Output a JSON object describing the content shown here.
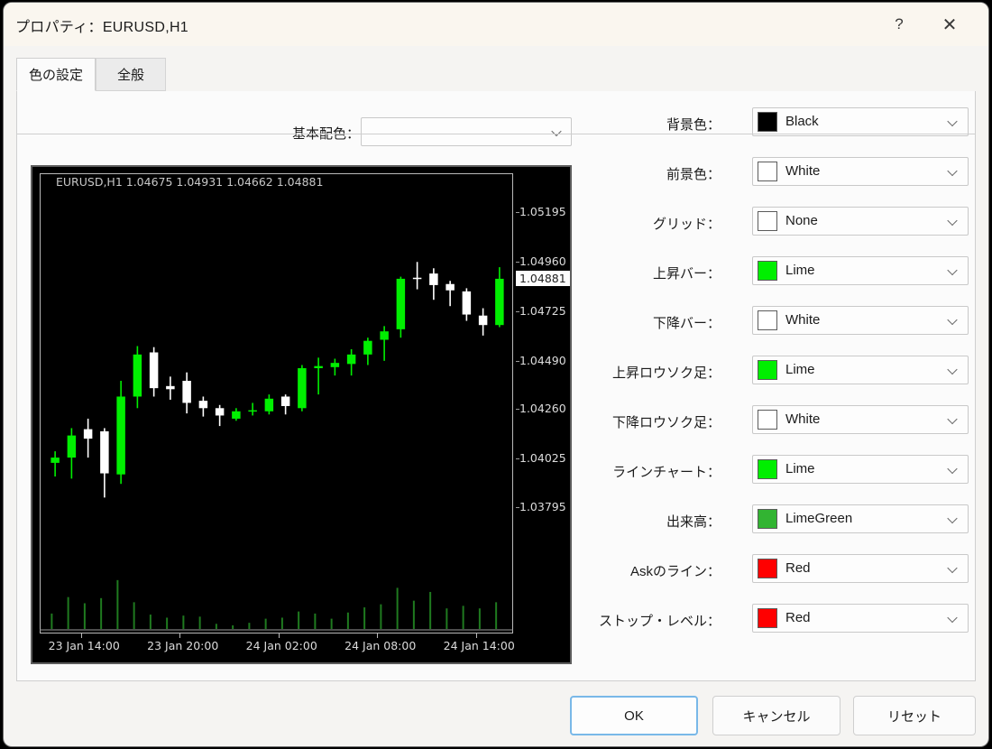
{
  "window": {
    "title": "プロパティ：EURUSD,H1",
    "help_icon": "?",
    "close_icon": "✕"
  },
  "tabs": [
    {
      "label": "色の設定",
      "active": true
    },
    {
      "label": "全般",
      "active": false
    }
  ],
  "scheme": {
    "label": "基本配色：",
    "value": "",
    "chevron_icon": "chevron-down-icon"
  },
  "color_rows": [
    {
      "label": "背景色：",
      "value": "Black",
      "hex": "#000000"
    },
    {
      "label": "前景色：",
      "value": "White",
      "hex": "#ffffff"
    },
    {
      "label": "グリッド：",
      "value": "None",
      "hex": "#ffffff"
    },
    {
      "label": "上昇バー：",
      "value": "Lime",
      "hex": "#00ef00"
    },
    {
      "label": "下降バー：",
      "value": "White",
      "hex": "#ffffff"
    },
    {
      "label": "上昇ロウソク足：",
      "value": "Lime",
      "hex": "#00ef00"
    },
    {
      "label": "下降ロウソク足：",
      "value": "White",
      "hex": "#ffffff"
    },
    {
      "label": "ラインチャート：",
      "value": "Lime",
      "hex": "#00ef00"
    },
    {
      "label": "出来高：",
      "value": "LimeGreen",
      "hex": "#32b432"
    },
    {
      "label": "Askのライン：",
      "value": "Red",
      "hex": "#ff0000"
    },
    {
      "label": "ストップ・レベル：",
      "value": "Red",
      "hex": "#ff0000"
    }
  ],
  "footer": {
    "ok": "OK",
    "cancel": "キャンセル",
    "reset": "リセット"
  },
  "chart_data": {
    "type": "candlestick",
    "title": "EURUSD,H1  1.04675 1.04931 1.04662 1.04881",
    "symbol": "EURUSD,H1",
    "ohlc": {
      "open": "1.04675",
      "high": "1.04931",
      "low": "1.04662",
      "close": "1.04881"
    },
    "background": "#000000",
    "up_color": "#00ef00",
    "down_color": "#ffffff",
    "volume_color": "#1f7a1f",
    "grid": false,
    "current_price": "1.04881",
    "ylim": [
      1.037,
      1.0527
    ],
    "ytick_labels": [
      "1.05195",
      "1.04960",
      "1.04725",
      "1.04490",
      "1.04260",
      "1.04025",
      "1.03795"
    ],
    "ytick_values": [
      1.05195,
      1.0496,
      1.04725,
      1.0449,
      1.0426,
      1.04025,
      1.03795
    ],
    "xtick_labels": [
      "23 Jan 14:00",
      "23 Jan 20:00",
      "24 Jan 02:00",
      "24 Jan 08:00",
      "24 Jan 14:00"
    ],
    "xtick_indices": [
      2,
      8,
      14,
      20,
      26
    ],
    "candles": [
      {
        "o": 1.04005,
        "h": 1.0406,
        "l": 1.0394,
        "c": 1.0403,
        "v": 0.3
      },
      {
        "o": 1.0403,
        "h": 1.0417,
        "l": 1.0393,
        "c": 1.04135,
        "v": 0.62
      },
      {
        "o": 1.04165,
        "h": 1.04215,
        "l": 1.0403,
        "c": 1.0412,
        "v": 0.5
      },
      {
        "o": 1.04155,
        "h": 1.0417,
        "l": 1.0384,
        "c": 1.03955,
        "v": 0.6
      },
      {
        "o": 1.0395,
        "h": 1.04395,
        "l": 1.03905,
        "c": 1.0432,
        "v": 0.95
      },
      {
        "o": 1.0432,
        "h": 1.0456,
        "l": 1.04265,
        "c": 1.0452,
        "v": 0.52
      },
      {
        "o": 1.0453,
        "h": 1.04555,
        "l": 1.0432,
        "c": 1.0436,
        "v": 0.28
      },
      {
        "o": 1.0437,
        "h": 1.04415,
        "l": 1.04305,
        "c": 1.04355,
        "v": 0.22
      },
      {
        "o": 1.04395,
        "h": 1.04435,
        "l": 1.0424,
        "c": 1.0429,
        "v": 0.26
      },
      {
        "o": 1.043,
        "h": 1.0432,
        "l": 1.04225,
        "c": 1.04265,
        "v": 0.24
      },
      {
        "o": 1.04265,
        "h": 1.0428,
        "l": 1.0418,
        "c": 1.0423,
        "v": 0.1
      },
      {
        "o": 1.04215,
        "h": 1.04265,
        "l": 1.04205,
        "c": 1.0425,
        "v": 0.07
      },
      {
        "o": 1.0425,
        "h": 1.0429,
        "l": 1.0423,
        "c": 1.04255,
        "v": 0.12
      },
      {
        "o": 1.0425,
        "h": 1.0433,
        "l": 1.04235,
        "c": 1.0431,
        "v": 0.2
      },
      {
        "o": 1.0432,
        "h": 1.0433,
        "l": 1.04235,
        "c": 1.04275,
        "v": 0.22
      },
      {
        "o": 1.04265,
        "h": 1.0447,
        "l": 1.0425,
        "c": 1.04455,
        "v": 0.34
      },
      {
        "o": 1.04455,
        "h": 1.04505,
        "l": 1.0433,
        "c": 1.04465,
        "v": 0.3
      },
      {
        "o": 1.0446,
        "h": 1.045,
        "l": 1.0442,
        "c": 1.0448,
        "v": 0.2
      },
      {
        "o": 1.04475,
        "h": 1.04545,
        "l": 1.0442,
        "c": 1.0452,
        "v": 0.32
      },
      {
        "o": 1.0452,
        "h": 1.046,
        "l": 1.0447,
        "c": 1.04585,
        "v": 0.42
      },
      {
        "o": 1.0459,
        "h": 1.04655,
        "l": 1.0449,
        "c": 1.0463,
        "v": 0.48
      },
      {
        "o": 1.0464,
        "h": 1.0489,
        "l": 1.046,
        "c": 1.0488,
        "v": 0.8
      },
      {
        "o": 1.04885,
        "h": 1.0496,
        "l": 1.0483,
        "c": 1.0488,
        "v": 0.55
      },
      {
        "o": 1.04905,
        "h": 1.0493,
        "l": 1.0478,
        "c": 1.0485,
        "v": 0.72
      },
      {
        "o": 1.04855,
        "h": 1.0487,
        "l": 1.0475,
        "c": 1.04825,
        "v": 0.4
      },
      {
        "o": 1.0482,
        "h": 1.04835,
        "l": 1.0468,
        "c": 1.0471,
        "v": 0.45
      },
      {
        "o": 1.04705,
        "h": 1.0474,
        "l": 1.0461,
        "c": 1.0466,
        "v": 0.4
      },
      {
        "o": 1.0466,
        "h": 1.04935,
        "l": 1.0465,
        "c": 1.0488,
        "v": 0.52
      }
    ]
  }
}
